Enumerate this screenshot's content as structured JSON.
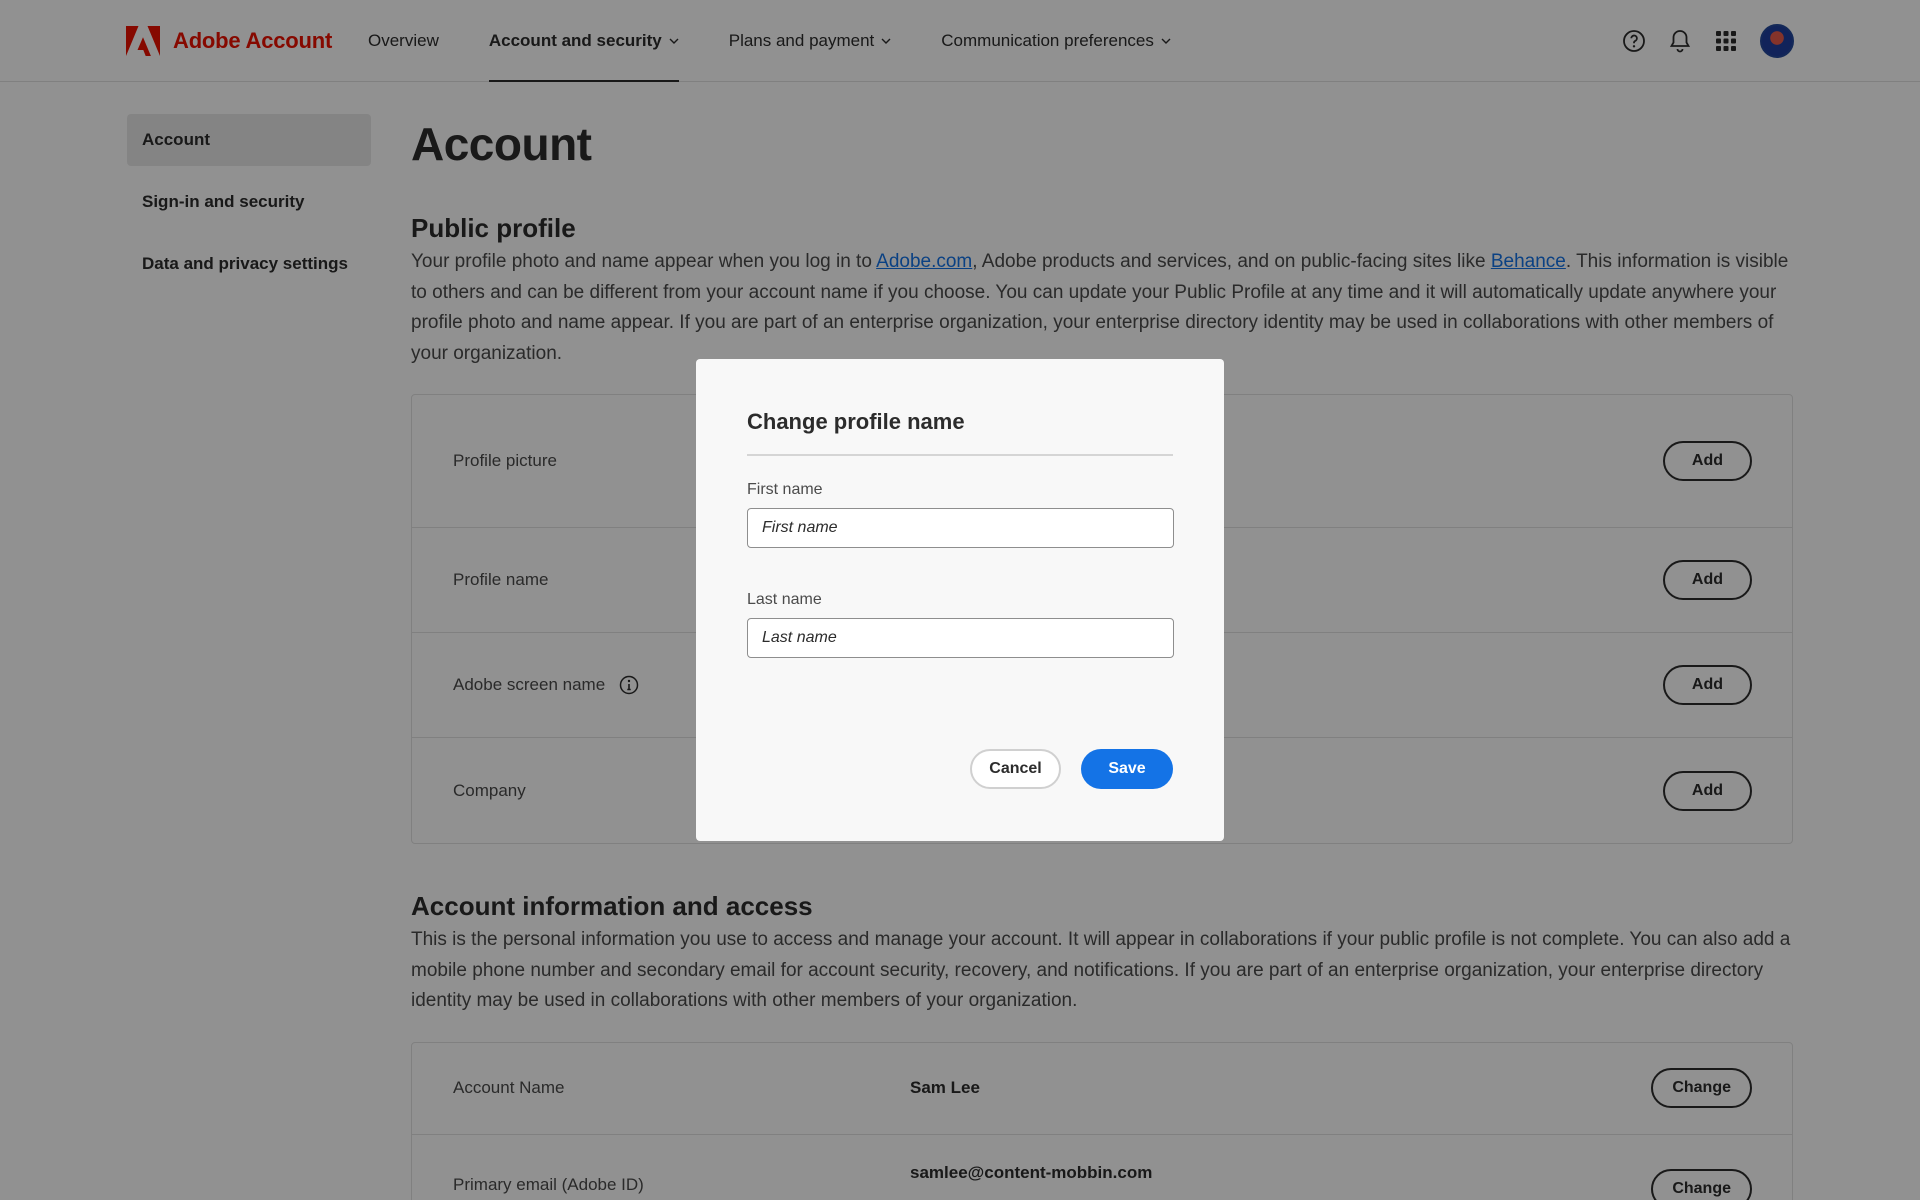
{
  "header": {
    "brand": "Adobe Account",
    "brand_color": "#eb1000",
    "nav": [
      {
        "label": "Overview",
        "dropdown": false,
        "active": false
      },
      {
        "label": "Account and security",
        "dropdown": true,
        "active": true
      },
      {
        "label": "Plans and payment",
        "dropdown": true,
        "active": false
      },
      {
        "label": "Communication preferences",
        "dropdown": true,
        "active": false
      }
    ],
    "icons": [
      "help-icon",
      "bell-icon",
      "apps-grid-icon",
      "avatar"
    ]
  },
  "sidebar": {
    "items": [
      {
        "label": "Account",
        "active": true
      },
      {
        "label": "Sign-in and security",
        "active": false
      },
      {
        "label": "Data and privacy settings",
        "active": false
      }
    ]
  },
  "main": {
    "title": "Account",
    "public_profile": {
      "title": "Public profile",
      "desc_part1": "Your profile photo and name appear when you log in to ",
      "link1": "Adobe.com",
      "desc_part2": ", Adobe products and services, and on public-facing sites like ",
      "link2": "Behance",
      "desc_part3": ". This information is visible to others and can be different from your account name if you choose. You can update your Public Profile at any time and it will automatically update anywhere your profile photo and name appear. If you are part of an enterprise organization, your enterprise directory identity may be used in collaborations with other members of your organization.",
      "rows": [
        {
          "label": "Profile picture",
          "button": "Add"
        },
        {
          "label": "Profile name",
          "button": "Add"
        },
        {
          "label": "Adobe screen name",
          "button": "Add",
          "info_icon": true
        },
        {
          "label": "Company",
          "button": "Add"
        }
      ]
    },
    "account_info": {
      "title": "Account information and access",
      "desc": "This is the personal information you use to access and manage your account. It will appear in collaborations if your public profile is not complete. You can also add a mobile phone number and secondary email for account security, recovery, and notifications. If you are part of an enterprise organization, your enterprise directory identity may be used in collaborations with other members of your organization.",
      "rows": [
        {
          "label": "Account Name",
          "value": "Sam Lee",
          "button": "Change"
        },
        {
          "label": "Primary email (Adobe ID)",
          "value": "samlee@content-mobbin.com",
          "button": "Change"
        }
      ]
    }
  },
  "dialog": {
    "title": "Change profile name",
    "first_name_label": "First name",
    "first_name_placeholder": "First name",
    "first_name_value": "",
    "last_name_label": "Last name",
    "last_name_placeholder": "Last name",
    "last_name_value": "",
    "cancel_label": "Cancel",
    "save_label": "Save",
    "save_color": "#1473e6"
  }
}
